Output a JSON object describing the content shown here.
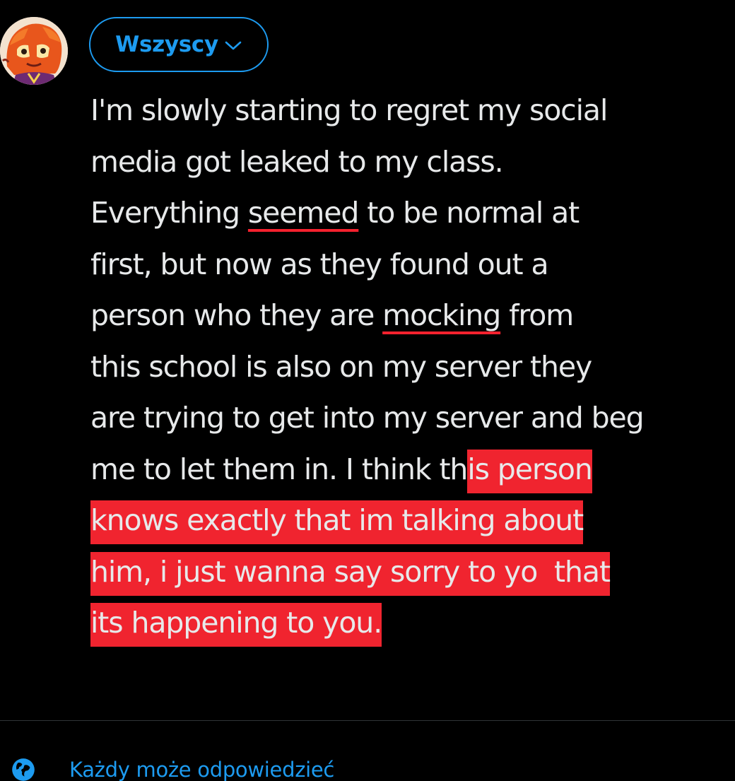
{
  "compose": {
    "audience": {
      "label": "Wszyscy",
      "icon": "chevron-down-icon",
      "color": "#1d9bf0"
    },
    "text": {
      "line1": "I'm slowly starting to regret my social",
      "line2": "media got leaked to my class.",
      "line3_before": "Everything ",
      "line3_misspelled": "seemed",
      "line3_after": " to be normal at",
      "line4": "first, but now as they found out a",
      "line5_before": "person who they are ",
      "line5_misspelled": "mocking",
      "line5_after": " from",
      "line6": "this school is also on my server they",
      "line7": "are trying to get into my server and beg",
      "line8_plain": "me to let them in. I think th",
      "line8_highlight": "is person",
      "line9_highlight": "knows exactly that im talking about",
      "line10_highlight": "him, i just wanna say sorry to yo  that",
      "line11_highlight": "its happening to you."
    },
    "highlight_color": "#f0242f",
    "spellcheck_color": "#f4212e"
  },
  "reply_setting": {
    "icon": "globe-icon",
    "label": "Każdy może odpowiedzieć"
  }
}
